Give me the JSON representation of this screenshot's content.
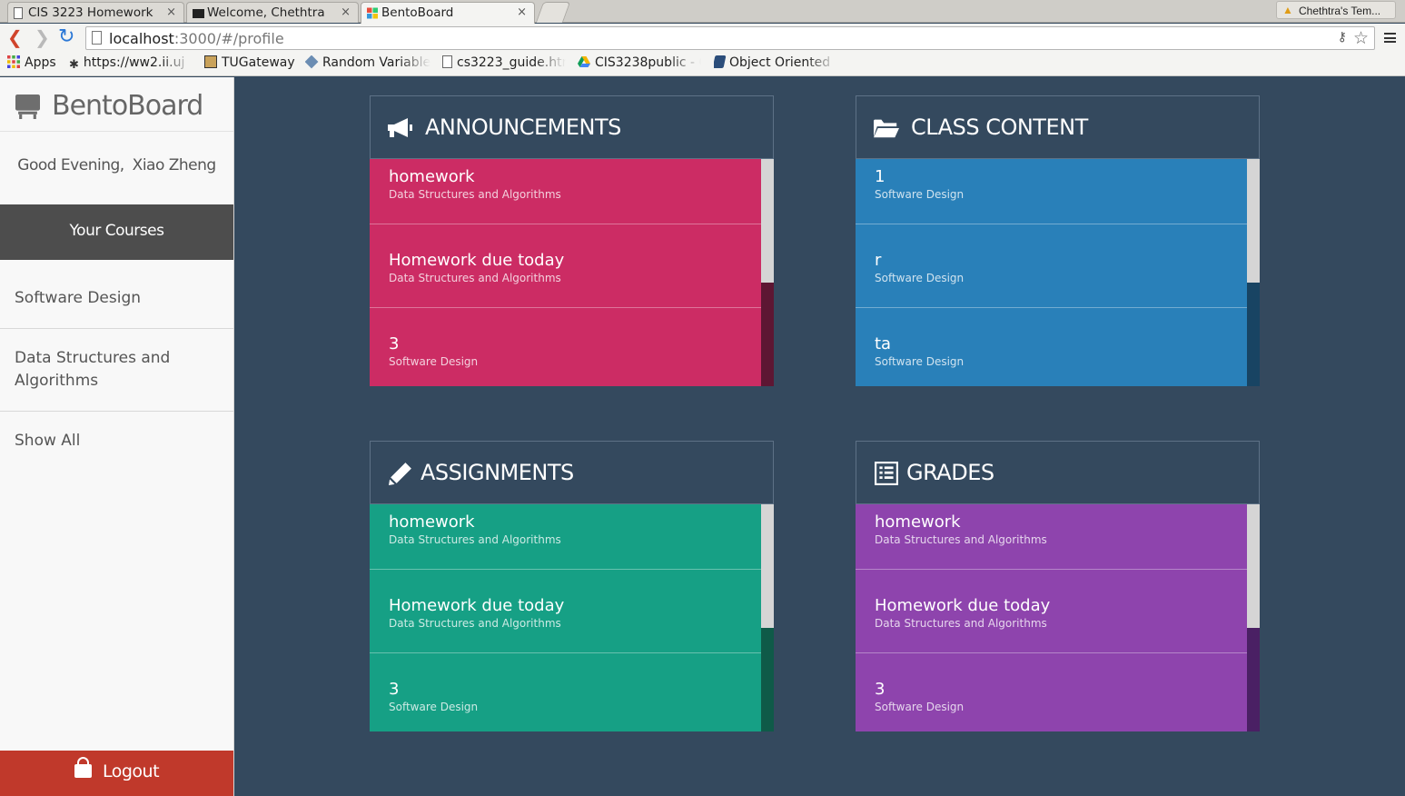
{
  "browser": {
    "tabs": [
      {
        "title": "CIS 3223 Homework",
        "active": false
      },
      {
        "title": "Welcome, Chethtra",
        "active": false
      },
      {
        "title": "BentoBoard",
        "active": true
      }
    ],
    "profile_name": "Chethtra's Tem...",
    "url_host": "localhost",
    "url_rest": ":3000/#/profile",
    "bookmarks": [
      {
        "label": "Apps",
        "icon": "apps-grid-icon"
      },
      {
        "label": "https://ww2.ii.uj",
        "icon": "paw-icon"
      },
      {
        "label": "TUGateway",
        "icon": "gateway-icon"
      },
      {
        "label": "Random Variable",
        "icon": "dice-icon"
      },
      {
        "label": "cs3223_guide.htr",
        "icon": "page-icon"
      },
      {
        "label": "CIS3238public - C",
        "icon": "drive-icon"
      },
      {
        "label": "Object Oriented",
        "icon": "logo-icon"
      }
    ]
  },
  "sidebar": {
    "brand": "BentoBoard",
    "greeting": "Good Evening,",
    "user_name": "Xiao Zheng",
    "courses_header": "Your Courses",
    "courses": [
      "Software Design",
      "Data Structures and Algorithms",
      "Show All"
    ],
    "logout": "Logout"
  },
  "panels": [
    {
      "id": "announcements",
      "title": "ANNOUNCEMENTS",
      "icon": "megaphone-icon",
      "color": "#cc2c64",
      "thumb": "#d5d5d5",
      "track": "#5d1633",
      "items": [
        {
          "title": "homework",
          "course": "Data Structures and Algorithms"
        },
        {
          "title": "Homework due today",
          "course": "Data Structures and Algorithms"
        },
        {
          "title": "3",
          "course": "Software Design"
        }
      ]
    },
    {
      "id": "class-content",
      "title": "CLASS CONTENT",
      "icon": "folder-open-icon",
      "color": "#2980b9",
      "thumb": "#d5d5d5",
      "track": "#184463",
      "items": [
        {
          "title": "1",
          "course": "Software Design"
        },
        {
          "title": "r",
          "course": "Software Design"
        },
        {
          "title": "ta",
          "course": "Software Design"
        }
      ]
    },
    {
      "id": "assignments",
      "title": "ASSIGNMENTS",
      "icon": "pencil-icon",
      "color": "#16a085",
      "thumb": "#d5d5d5",
      "track": "#0f5a48",
      "items": [
        {
          "title": "homework",
          "course": "Data Structures and Algorithms"
        },
        {
          "title": "Homework due today",
          "course": "Data Structures and Algorithms"
        },
        {
          "title": "3",
          "course": "Software Design"
        }
      ]
    },
    {
      "id": "grades",
      "title": "GRADES",
      "icon": "list-icon",
      "color": "#8e44ad",
      "thumb": "#d5d5d5",
      "track": "#4a2064",
      "items": [
        {
          "title": "homework",
          "course": "Data Structures and Algorithms"
        },
        {
          "title": "Homework due today",
          "course": "Data Structures and Algorithms"
        },
        {
          "title": "3",
          "course": "Software Design"
        }
      ]
    }
  ]
}
